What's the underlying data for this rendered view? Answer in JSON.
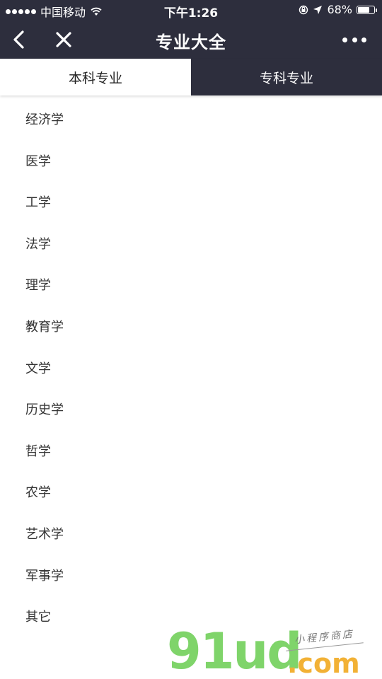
{
  "status_bar": {
    "carrier": "中国移动",
    "time": "下午1:26",
    "battery_text": "68%",
    "battery_level": 0.68,
    "icons": [
      "signal-dots",
      "wifi-icon",
      "orientation-lock-icon",
      "location-arrow-icon",
      "battery-icon"
    ]
  },
  "nav": {
    "title": "专业大全",
    "back_icon": "chevron-left-icon",
    "close_icon": "close-icon",
    "more_icon": "more-icon"
  },
  "tabs": [
    {
      "label": "本科专业",
      "active": true
    },
    {
      "label": "专科专业",
      "active": false
    }
  ],
  "majors": [
    "经济学",
    "医学",
    "工学",
    "法学",
    "理学",
    "教育学",
    "文学",
    "历史学",
    "哲学",
    "农学",
    "艺术学",
    "军事学",
    "其它"
  ],
  "watermark": {
    "logo": "91ud",
    "domain": ".com",
    "tagline": "小程序商店"
  },
  "colors": {
    "header_bg": "#2d2e3d",
    "header_text": "#ffffff",
    "list_text": "#333333",
    "watermark_green": "#7fd46a",
    "watermark_orange": "#f2b135"
  }
}
